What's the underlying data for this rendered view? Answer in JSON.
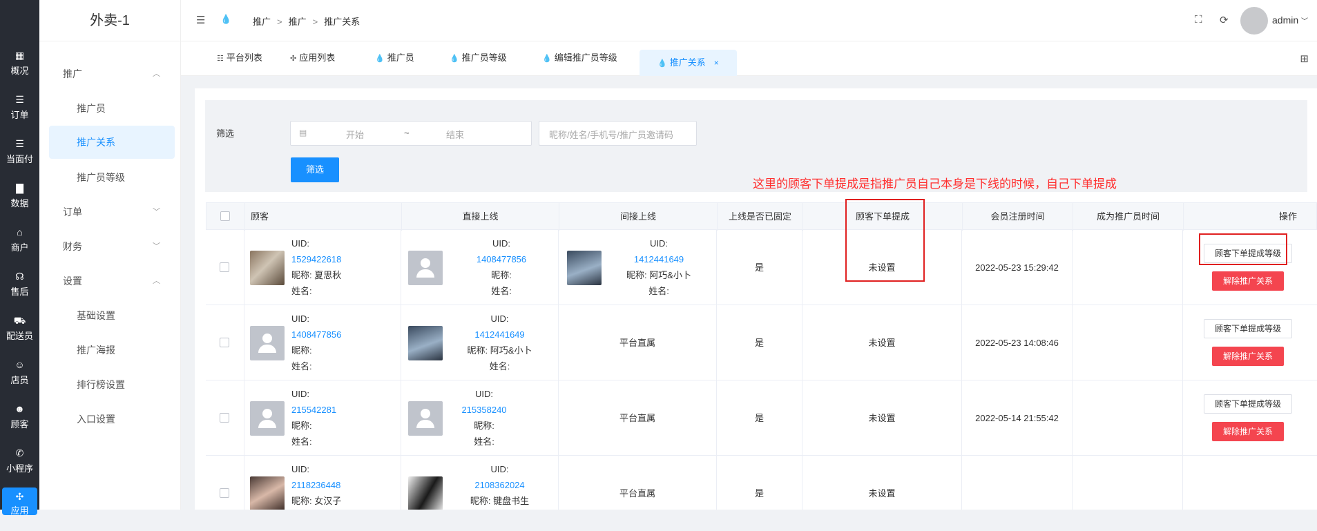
{
  "rail": [
    {
      "label": "概况",
      "icon": "dashboard-icon",
      "glyph": "▦"
    },
    {
      "label": "订单",
      "icon": "list-icon",
      "glyph": "☰"
    },
    {
      "label": "当面付",
      "icon": "list-icon",
      "glyph": "☰"
    },
    {
      "label": "数据",
      "icon": "bar-chart-icon",
      "glyph": "▇"
    },
    {
      "label": "商户",
      "icon": "store-icon",
      "glyph": "⌂"
    },
    {
      "label": "售后",
      "icon": "headset-icon",
      "glyph": "☊"
    },
    {
      "label": "配送员",
      "icon": "delivery-icon",
      "glyph": "⛟"
    },
    {
      "label": "店员",
      "icon": "user-icon",
      "glyph": "☺"
    },
    {
      "label": "顾客",
      "icon": "customer-icon",
      "glyph": "☻"
    },
    {
      "label": "小程序",
      "icon": "wechat-icon",
      "glyph": "✆"
    },
    {
      "label": "应用",
      "icon": "apps-icon",
      "glyph": "✣"
    }
  ],
  "sidebar": {
    "title": "外卖-1",
    "items": [
      {
        "label": "推广",
        "kind": "group",
        "chev": "︿"
      },
      {
        "label": "推广员",
        "kind": "sub"
      },
      {
        "label": "推广关系",
        "kind": "active"
      },
      {
        "label": "推广员等级",
        "kind": "sub"
      },
      {
        "label": "订单",
        "kind": "group",
        "chev": "﹀"
      },
      {
        "label": "财务",
        "kind": "group",
        "chev": "﹀"
      },
      {
        "label": "设置",
        "kind": "group",
        "chev": "︿"
      },
      {
        "label": "基础设置",
        "kind": "sub"
      },
      {
        "label": "推广海报",
        "kind": "sub"
      },
      {
        "label": "排行榜设置",
        "kind": "sub"
      },
      {
        "label": "入口设置",
        "kind": "sub"
      }
    ]
  },
  "header": {
    "breadcrumb": [
      "推广",
      "推广",
      "推广关系"
    ],
    "user": "admin"
  },
  "tabs": [
    {
      "label": "平台列表",
      "glyph": "☷"
    },
    {
      "label": "应用列表",
      "glyph": "✣"
    },
    {
      "label": "推广员",
      "glyph": "💧"
    },
    {
      "label": "推广员等级",
      "glyph": "💧"
    },
    {
      "label": "编辑推广员等级",
      "glyph": "💧"
    },
    {
      "label": "推广关系",
      "glyph": "💧",
      "active": true,
      "close": "×"
    }
  ],
  "filter": {
    "label": "筛选",
    "start_placeholder": "开始",
    "range_sep": "~",
    "end_placeholder": "结束",
    "keyword_placeholder": "昵称/姓名/手机号/推广员邀请码",
    "button": "筛选"
  },
  "annotation": "这里的顾客下单提成是指推广员自己本身是下线的时候，自己下单提成",
  "table": {
    "columns": [
      "顾客",
      "直接上线",
      "间接上线",
      "上线是否已固定",
      "顾客下单提成",
      "会员注册时间",
      "成为推广员时间",
      "操作"
    ],
    "rows": [
      {
        "customer": {
          "uid_label": "UID:",
          "uid": "1529422618",
          "nick": "昵称: 夏思秋",
          "name": "姓名:"
        },
        "direct": {
          "uid_label": "UID:",
          "uid": "1408477856",
          "nick": "昵称:",
          "name": "姓名:"
        },
        "indirect": {
          "uid_label": "UID:",
          "uid": "1412441649",
          "nick": "昵称: 阿巧&小卜",
          "name": "姓名:"
        },
        "fixed": "是",
        "commission": "未设置",
        "reg_time": "2022-05-23 15:29:42",
        "promoter_time": "",
        "btn_level": "顾客下单提成等级",
        "btn_unbind": "解除推广关系"
      },
      {
        "customer": {
          "uid_label": "UID:",
          "uid": "1408477856",
          "nick": "昵称:",
          "name": "姓名:"
        },
        "direct": {
          "uid_label": "UID:",
          "uid": "1412441649",
          "nick": "昵称: 阿巧&小卜",
          "name": "姓名:"
        },
        "indirect_text": "平台直属",
        "fixed": "是",
        "commission": "未设置",
        "reg_time": "2022-05-23 14:08:46",
        "promoter_time": "",
        "btn_level": "顾客下单提成等级",
        "btn_unbind": "解除推广关系"
      },
      {
        "customer": {
          "uid_label": "UID:",
          "uid": "215542281",
          "nick": "昵称:",
          "name": "姓名:"
        },
        "direct": {
          "uid_label": "UID:",
          "uid": "215358240",
          "nick": "昵称:",
          "name": "姓名:"
        },
        "indirect_text": "平台直属",
        "fixed": "是",
        "commission": "未设置",
        "reg_time": "2022-05-14 21:55:42",
        "promoter_time": "",
        "btn_level": "顾客下单提成等级",
        "btn_unbind": "解除推广关系"
      },
      {
        "customer": {
          "uid_label": "UID:",
          "uid": "2118236448",
          "nick": "昵称: 女汉子",
          "name": ""
        },
        "direct": {
          "uid_label": "UID:",
          "uid": "2108362024",
          "nick": "昵称: 键盘书生",
          "name": ""
        },
        "indirect_text": "平台直属",
        "fixed": "是",
        "commission": "未设置",
        "reg_time": "",
        "promoter_time": "",
        "btn_level": "",
        "btn_unbind": ""
      }
    ]
  },
  "colors": {
    "primary": "#1890ff",
    "danger": "#f4454f",
    "annotation": "#ff3030",
    "rail": "#282c34"
  }
}
